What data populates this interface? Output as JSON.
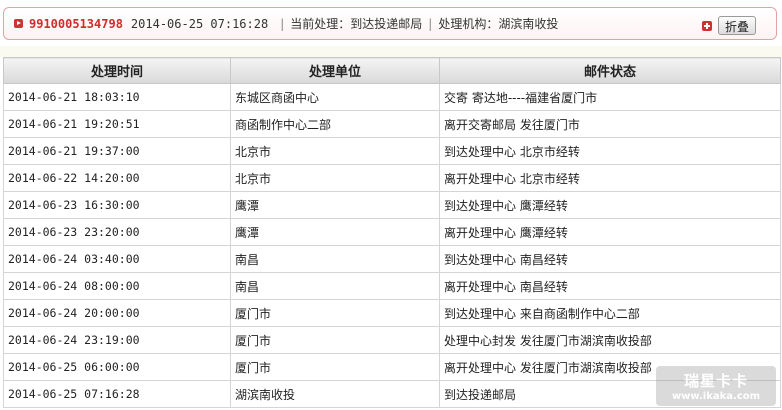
{
  "summary": {
    "tracking_number": "9910005134798",
    "timestamp": "2014-06-25 07:16:28",
    "separator": "|",
    "current_label": "当前处理：",
    "current_value": "到达投递邮局",
    "org_label": "处理机构：",
    "org_value": "湖滨南收投",
    "fold_label": "折叠"
  },
  "table": {
    "headers": [
      "处理时间",
      "处理单位",
      "邮件状态"
    ],
    "rows": [
      {
        "time": "2014-06-21 18:03:10",
        "unit": "东城区商函中心",
        "status": "交寄 寄达地----福建省厦门市"
      },
      {
        "time": "2014-06-21 19:20:51",
        "unit": "商函制作中心二部",
        "status": "离开交寄邮局 发往厦门市"
      },
      {
        "time": "2014-06-21 19:37:00",
        "unit": "北京市",
        "status": "到达处理中心 北京市经转"
      },
      {
        "time": "2014-06-22 14:20:00",
        "unit": "北京市",
        "status": "离开处理中心 北京市经转"
      },
      {
        "time": "2014-06-23 16:30:00",
        "unit": "鹰潭",
        "status": "到达处理中心 鹰潭经转"
      },
      {
        "time": "2014-06-23 23:20:00",
        "unit": "鹰潭",
        "status": "离开处理中心 鹰潭经转"
      },
      {
        "time": "2014-06-24 03:40:00",
        "unit": "南昌",
        "status": "到达处理中心 南昌经转"
      },
      {
        "time": "2014-06-24 08:00:00",
        "unit": "南昌",
        "status": "离开处理中心 南昌经转"
      },
      {
        "time": "2014-06-24 20:00:00",
        "unit": "厦门市",
        "status": "到达处理中心 来自商函制作中心二部"
      },
      {
        "time": "2014-06-24 23:19:00",
        "unit": "厦门市",
        "status": "处理中心封发 发往厦门市湖滨南收投部"
      },
      {
        "time": "2014-06-25 06:00:00",
        "unit": "厦门市",
        "status": "离开处理中心 发往厦门市湖滨南收投部"
      },
      {
        "time": "2014-06-25 07:16:28",
        "unit": "湖滨南收投",
        "status": "到达投递邮局"
      }
    ]
  },
  "watermark": {
    "title": "瑞星卡卡",
    "url": "www.ikaka.com"
  },
  "colors": {
    "accent": "#d42a2a",
    "border": "#e2a3a3"
  }
}
